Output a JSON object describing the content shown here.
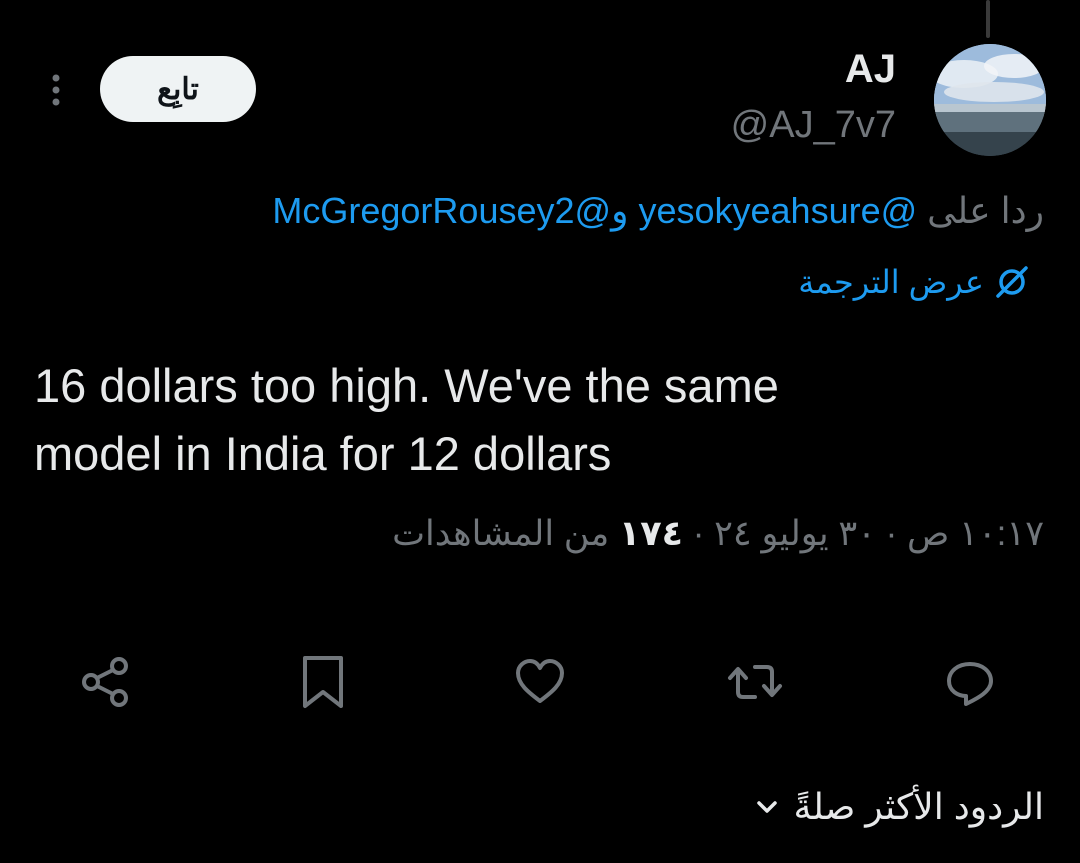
{
  "author": {
    "display_name": "AJ",
    "handle": "@AJ_7v7"
  },
  "follow_button": {
    "label": "تابِع"
  },
  "reply_context": {
    "prefix": "ردا على",
    "mention_1": "@yesokyeahsure",
    "connector": "و",
    "mention_2": "@McGregorRousey2"
  },
  "translate": {
    "label": "عرض الترجمة"
  },
  "tweet": {
    "line_1": "16 dollars too high. We've the same",
    "line_2": "model in India for 12 dollars"
  },
  "meta": {
    "time_date": "١٠:١٧ ص · ٣٠ يوليو ٢٤ · ",
    "views_count": "١٧٤",
    "views_label": " من المشاهدات"
  },
  "actions": {
    "icons": [
      "reply-icon",
      "retweet-icon",
      "like-icon",
      "bookmark-icon",
      "share-icon"
    ]
  },
  "replies_sort": {
    "label": "الردود الأكثر صلةً"
  },
  "colors": {
    "background": "#000000",
    "primary_text": "#e7e9ea",
    "secondary_text": "#71767b",
    "accent": "#1d9bf0",
    "follow_bg": "#eff3f4"
  }
}
